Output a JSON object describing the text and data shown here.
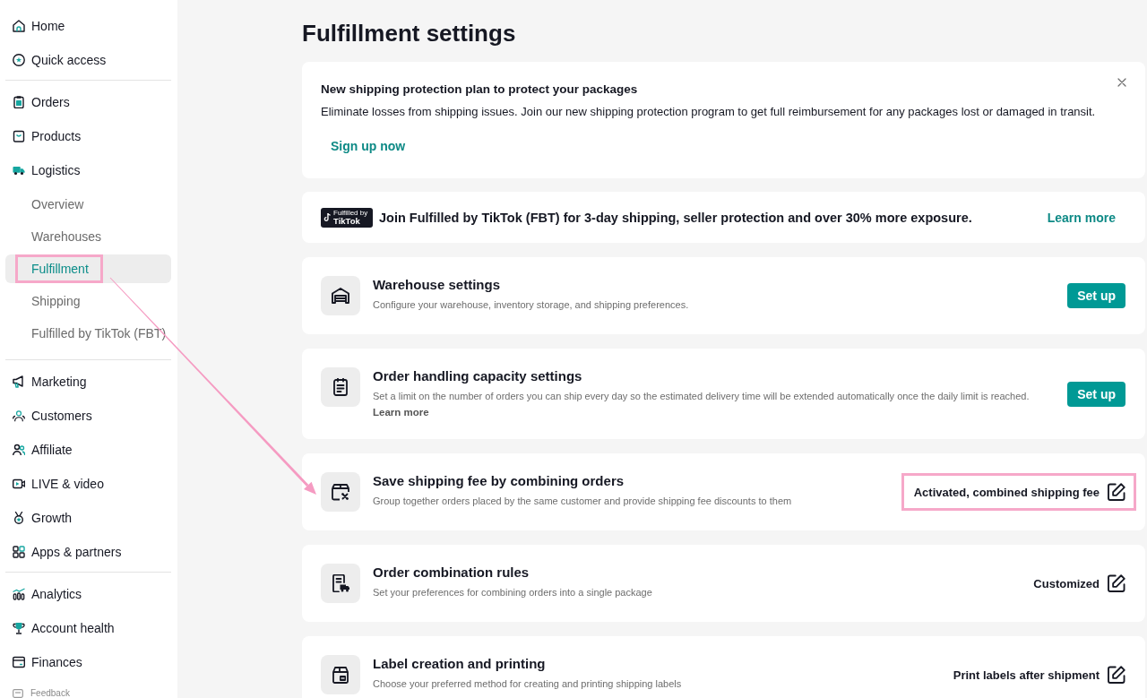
{
  "sidebar": {
    "sections": [
      {
        "items": [
          {
            "label": "Home",
            "selected": false
          },
          {
            "label": "Quick access",
            "selected": false
          }
        ]
      },
      {
        "items": [
          {
            "label": "Orders",
            "selected": false
          },
          {
            "label": "Products",
            "selected": false
          },
          {
            "label": "Logistics",
            "selected": false,
            "children": [
              {
                "label": "Overview",
                "selected": false,
                "highlighted": false
              },
              {
                "label": "Warehouses",
                "selected": false,
                "highlighted": false
              },
              {
                "label": "Fulfillment",
                "selected": true,
                "highlighted": true
              },
              {
                "label": "Shipping",
                "selected": false,
                "highlighted": false
              },
              {
                "label": "Fulfilled by TikTok (FBT)",
                "selected": false,
                "highlighted": false
              }
            ]
          }
        ]
      },
      {
        "items": [
          {
            "label": "Marketing",
            "selected": false
          },
          {
            "label": "Customers",
            "selected": false
          },
          {
            "label": "Affiliate",
            "selected": false
          },
          {
            "label": "LIVE & video",
            "selected": false
          },
          {
            "label": "Growth",
            "selected": false
          },
          {
            "label": "Apps & partners",
            "selected": false
          }
        ]
      },
      {
        "items": [
          {
            "label": "Analytics",
            "selected": false
          },
          {
            "label": "Account health",
            "selected": false
          },
          {
            "label": "Finances",
            "selected": false
          }
        ]
      }
    ],
    "feedback": {
      "label": "Feedback"
    }
  },
  "page": {
    "title": "Fulfillment settings"
  },
  "banner": {
    "title": "New shipping protection plan to protect your packages",
    "text": "Eliminate losses from shipping issues. Join our new shipping protection program to get full reimbursement for any packages lost or damaged in transit.",
    "action": "Sign up now"
  },
  "fbt_promo": {
    "logo_caption": "Fulfilled by",
    "logo_wordmark": "TikTok",
    "text": "Join Fulfilled by TikTok (FBT) for 3-day shipping, seller protection and over 30% more exposure.",
    "link": "Learn more"
  },
  "settings": [
    {
      "title": "Warehouse settings",
      "description": "Configure your warehouse, inventory storage, and shipping preferences.",
      "kind": "button",
      "action": "Set up",
      "highlighted": false
    },
    {
      "title": "Order handling capacity settings",
      "description": "Set a limit on the number of orders you can ship every day so the estimated delivery time will be extended automatically once the daily limit is reached.",
      "link": "Learn more",
      "kind": "button",
      "action": "Set up",
      "highlighted": false
    },
    {
      "title": "Save shipping fee by combining orders",
      "description": "Group together orders placed by the same customer and provide shipping fee discounts to them",
      "kind": "status",
      "status": "Activated, combined shipping fee",
      "highlighted": true
    },
    {
      "title": "Order combination rules",
      "description": "Set your preferences for combining orders into a single package",
      "kind": "status",
      "status": "Customized",
      "highlighted": false
    },
    {
      "title": "Label creation and printing",
      "description": "Choose your preferred method for creating and printing shipping labels",
      "kind": "status",
      "status": "Print labels after shipment",
      "highlighted": false
    }
  ]
}
